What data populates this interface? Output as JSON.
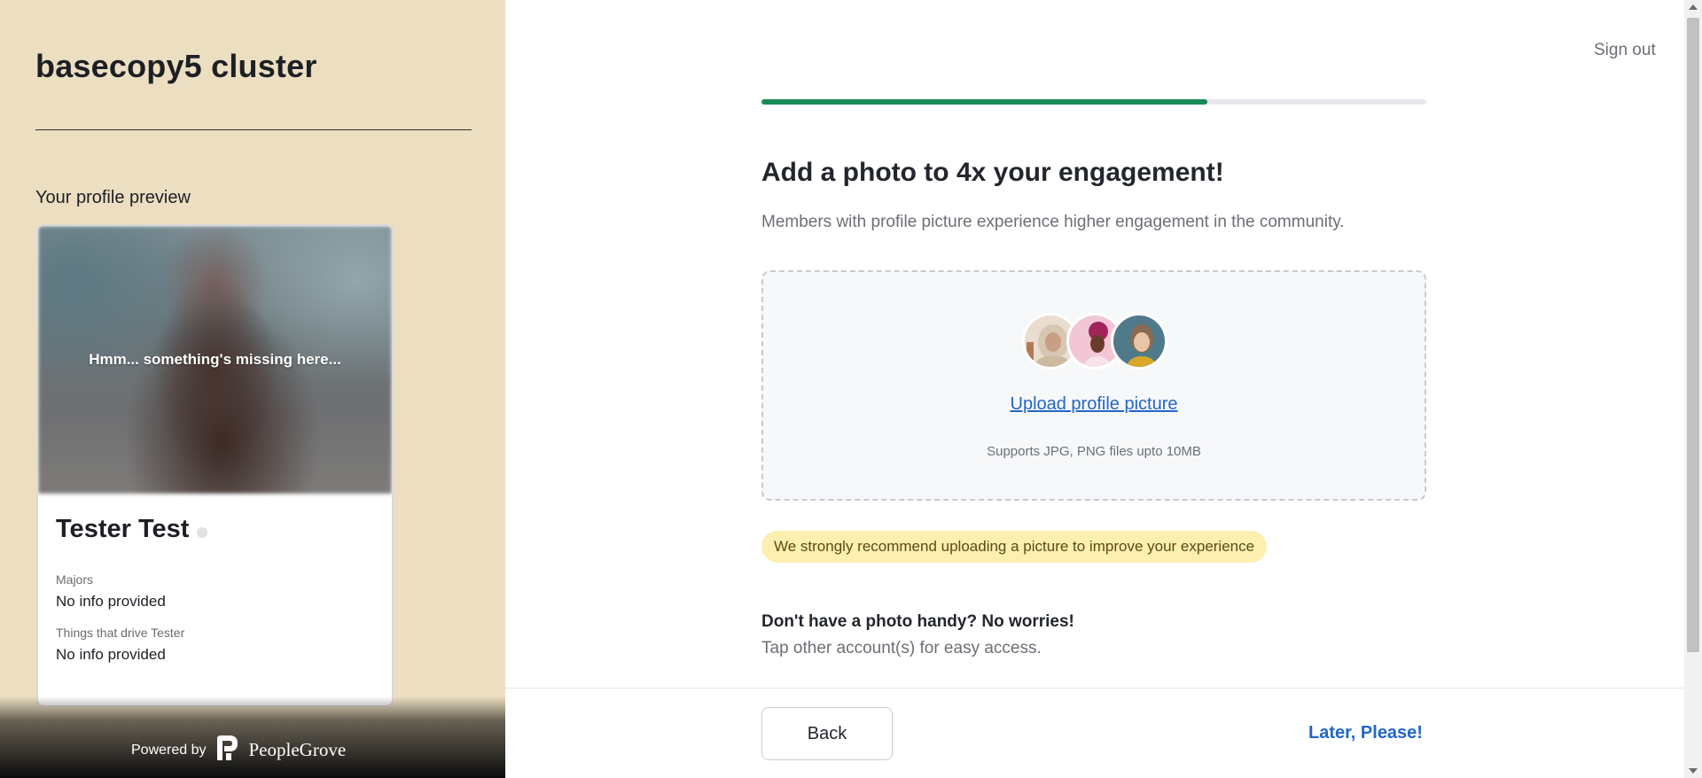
{
  "sidebar": {
    "cluster_title": "basecopy5 cluster",
    "preview_label": "Your profile preview",
    "card": {
      "photo_placeholder": "Hmm... something's missing here...",
      "name": "Tester Test",
      "fields": [
        {
          "label": "Majors",
          "value": "No info provided"
        },
        {
          "label": "Things that drive Tester",
          "value": "No info provided"
        }
      ]
    },
    "powered_by": "Powered by",
    "brand_name": "PeopleGrove"
  },
  "header": {
    "sign_out": "Sign out"
  },
  "progress": {
    "fraction": 0.67,
    "fill_color": "#1a8a5b"
  },
  "main": {
    "heading": "Add a photo to 4x your engagement!",
    "subheading": "Members with profile picture experience higher engagement in the community.",
    "upload": {
      "link_label": "Upload profile picture",
      "supports_text": "Supports JPG, PNG files upto 10MB"
    },
    "recommend_text": "We strongly recommend uploading a picture to improve your experience",
    "no_photo_title": "Don't have a photo handy? No worries!",
    "no_photo_sub": "Tap other account(s) for easy access."
  },
  "footer": {
    "back_label": "Back",
    "later_label": "Later, Please!"
  },
  "colors": {
    "sidebar_bg": "#ecdfc1",
    "accent_link": "#2266c8",
    "recommend_bg": "#fcefb0"
  }
}
